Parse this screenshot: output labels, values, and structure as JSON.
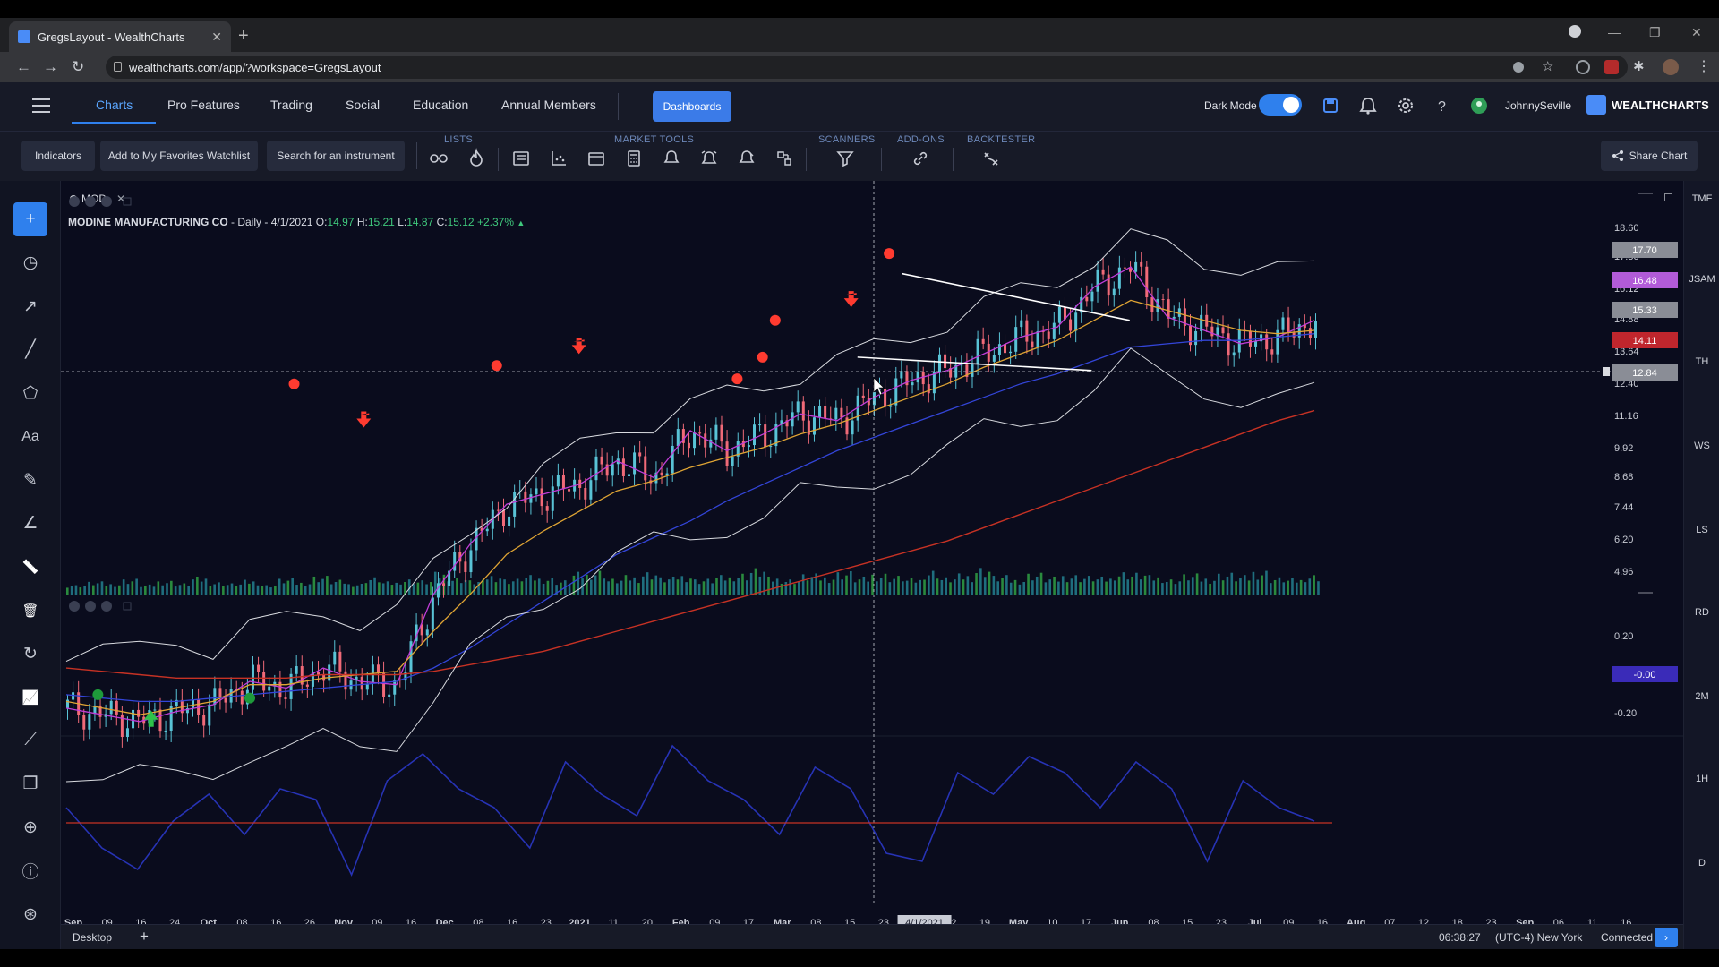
{
  "browser": {
    "tab_title": "GregsLayout - WealthCharts",
    "url": "wealthcharts.com/app/?workspace=GregsLayout"
  },
  "header": {
    "nav": [
      "Charts",
      "Pro Features",
      "Trading",
      "Social",
      "Education",
      "Annual Members"
    ],
    "dashboards": "Dashboards",
    "dark_mode_label": "Dark Mode",
    "username": "JohnnySeville",
    "brand": "WEALTHCHARTS"
  },
  "toolbar": {
    "indicators": "Indicators",
    "add_favorites": "Add to My Favorites Watchlist",
    "search": "Search for an instrument",
    "groups": {
      "lists": "LISTS",
      "market_tools": "MARKET TOOLS",
      "scanners": "SCANNERS",
      "addons": "ADD-ONS",
      "backtester": "BACKTESTER"
    },
    "share": "Share Chart"
  },
  "chart": {
    "tab_symbol": "MOD",
    "legend": {
      "name": "MODINE MANUFACTURING CO",
      "interval": "- Daily -",
      "date": "4/1/2021",
      "o_label": "O:",
      "o": "14.97",
      "h_label": "H:",
      "h": "15.21",
      "l_label": "L:",
      "l": "14.87",
      "c_label": "C:",
      "c": "15.12",
      "change": "+2.37%"
    },
    "price_ticks": [
      "18.60",
      "17.36",
      "16.12",
      "14.88",
      "13.64",
      "12.40",
      "11.16",
      "9.92",
      "8.68",
      "7.44",
      "6.20",
      "4.96"
    ],
    "price_tags": [
      {
        "label": "17.70",
        "color": "#8a8d96"
      },
      {
        "label": "16.48",
        "color": "#b25bd8"
      },
      {
        "label": "15.33",
        "color": "#8a8d96"
      },
      {
        "label": "14.11",
        "color": "#c0262d"
      },
      {
        "label": "12.84",
        "color": "#8a8d96"
      }
    ],
    "osc_ticks": [
      "0.20",
      "-0.20"
    ],
    "osc_tag": "-0.00",
    "x_ticks": [
      "Sep",
      "09",
      "16",
      "24",
      "Oct",
      "08",
      "16",
      "26",
      "Nov",
      "09",
      "16",
      "Dec",
      "08",
      "16",
      "23",
      "2021",
      "11",
      "20",
      "Feb",
      "09",
      "17",
      "Mar",
      "08",
      "15",
      "23",
      "4/1/2021",
      "12",
      "19",
      "May",
      "10",
      "17",
      "Jun",
      "08",
      "15",
      "23",
      "Jul",
      "09",
      "16",
      "Aug",
      "07",
      "12",
      "18",
      "23",
      "Sep",
      "06",
      "11",
      "16"
    ],
    "x_major": [
      "Sep",
      "Oct",
      "Nov",
      "Dec",
      "2021",
      "Feb",
      "Mar",
      "May",
      "Jun",
      "Jul",
      "Aug",
      "Sep"
    ],
    "x_highlight": "4/1/2021"
  },
  "chart_data": {
    "type": "line",
    "series": [
      {
        "values": [
          5.2,
          5.0,
          4.8,
          5.1,
          5.3,
          6.0,
          5.8,
          6.4,
          6.0,
          5.9,
          8.6,
          10.1,
          11.3,
          11.6,
          11.9,
          12.6,
          12.1,
          13.5,
          12.9,
          13.4,
          14.0,
          13.8,
          14.5,
          15.0,
          15.3,
          15.8,
          16.3,
          16.6,
          17.8,
          18.4,
          16.9,
          16.5,
          16.1,
          16.3,
          16.8
        ]
      },
      {
        "values": [
          5.4,
          5.2,
          5.0,
          5.2,
          5.4,
          5.9,
          5.9,
          6.1,
          6.2,
          6.3,
          7.5,
          8.6,
          9.8,
          10.5,
          11.1,
          11.7,
          12.0,
          12.4,
          12.7,
          13.0,
          13.4,
          13.7,
          14.1,
          14.5,
          14.9,
          15.4,
          15.8,
          16.2,
          16.8,
          17.4,
          17.1,
          16.8,
          16.5,
          16.4,
          16.5
        ]
      },
      {
        "values": [
          5.6,
          5.5,
          5.4,
          5.4,
          5.5,
          5.6,
          5.7,
          5.8,
          5.9,
          6.0,
          6.4,
          7.0,
          7.7,
          8.4,
          9.1,
          9.8,
          10.3,
          10.8,
          11.4,
          11.9,
          12.4,
          12.9,
          13.3,
          13.7,
          14.1,
          14.5,
          14.9,
          15.2,
          15.6,
          16.0,
          16.1,
          16.2,
          16.2,
          16.3,
          16.4
        ]
      },
      {
        "values": [
          6.4,
          6.3,
          6.2,
          6.1,
          6.1,
          6.1,
          6.1,
          6.2,
          6.2,
          6.2,
          6.3,
          6.5,
          6.7,
          6.9,
          7.2,
          7.5,
          7.8,
          8.1,
          8.4,
          8.7,
          9.0,
          9.3,
          9.6,
          9.9,
          10.2,
          10.6,
          11.0,
          11.4,
          11.8,
          12.2,
          12.6,
          13.0,
          13.4,
          13.8,
          14.1
        ]
      }
    ],
    "ylim": [
      4.5,
      19.5
    ],
    "markers": {
      "sell_dots": [
        [
          0.18,
          14.9
        ],
        [
          0.34,
          15.45
        ],
        [
          0.53,
          15.05
        ],
        [
          0.55,
          15.7
        ],
        [
          0.56,
          16.8
        ],
        [
          0.65,
          18.8
        ]
      ],
      "sell_arrows": [
        [
          0.235,
          13.7
        ],
        [
          0.405,
          15.9
        ],
        [
          0.62,
          17.3
        ]
      ],
      "buy_dots": [
        [
          0.025,
          5.6
        ],
        [
          0.145,
          5.5
        ]
      ],
      "buy_arrows": [
        [
          0.067,
          4.8
        ]
      ]
    },
    "triangle": {
      "upper": [
        [
          0.66,
          18.2
        ],
        [
          0.84,
          16.8
        ]
      ],
      "lower": [
        [
          0.625,
          15.7
        ],
        [
          0.81,
          15.3
        ]
      ]
    },
    "oscillator": {
      "values": [
        0.05,
        -0.1,
        -0.18,
        0.0,
        0.1,
        -0.05,
        0.12,
        0.08,
        -0.2,
        0.15,
        0.25,
        0.12,
        0.05,
        -0.1,
        0.22,
        0.1,
        0.02,
        0.28,
        0.15,
        0.08,
        -0.05,
        0.2,
        0.12,
        -0.12,
        -0.15,
        0.18,
        0.1,
        0.24,
        0.18,
        0.05,
        0.22,
        0.12,
        -0.15,
        0.15,
        0.05,
        0.0
      ],
      "ylim": [
        -0.3,
        0.3
      ]
    },
    "volume": [
      4,
      6,
      5,
      8,
      4,
      7,
      5,
      9,
      6,
      5,
      7,
      4,
      8,
      6,
      10,
      7,
      5,
      9,
      6,
      8,
      7,
      12,
      9,
      7,
      11,
      8,
      10,
      9,
      7,
      12,
      14,
      8,
      10,
      13,
      9,
      11,
      8,
      10,
      12,
      15,
      9,
      8,
      11,
      10,
      13,
      9,
      12,
      10,
      8,
      14,
      9,
      11,
      16,
      10,
      8,
      12,
      9,
      11,
      10,
      9,
      13,
      12,
      10,
      8,
      11,
      9,
      12,
      10,
      14,
      9,
      8,
      11
    ]
  },
  "left_tools": [
    "plus-icon",
    "clock-icon",
    "trend-icon",
    "line-icon",
    "shapes-icon",
    "text-icon",
    "pencil-icon",
    "angle-icon",
    "ruler-icon",
    "trash-icon",
    "refresh-icon",
    "chart-line-icon",
    "nodes-icon",
    "layers-icon",
    "crosshair-icon",
    "info-icon",
    "globe-icon"
  ],
  "right_labels": [
    "TMF",
    "JSAM",
    "TH",
    "WS",
    "LS",
    "RD",
    "2M",
    "1H",
    "D"
  ],
  "status": {
    "workspace": "Desktop",
    "time": "06:38:27",
    "timezone": "(UTC-4) New York",
    "connection": "Connected"
  }
}
